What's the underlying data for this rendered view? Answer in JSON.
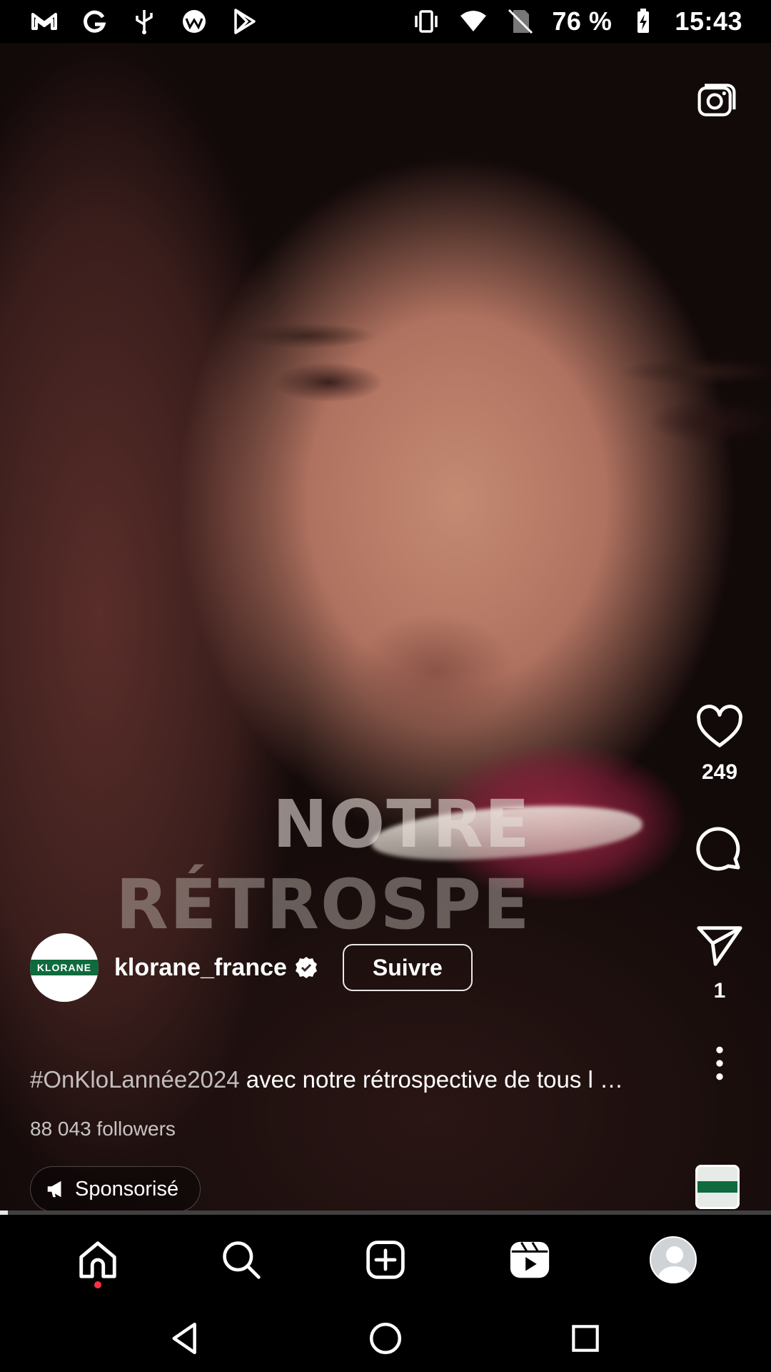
{
  "status_bar": {
    "battery": "76 %",
    "time": "15:43",
    "left_icons": [
      "gmail-icon",
      "google-icon",
      "usb-icon",
      "app-icon",
      "play-store-icon"
    ],
    "right_icons": [
      "vibrate-icon",
      "wifi-icon",
      "no-sim-icon",
      "battery-charging-icon"
    ]
  },
  "reel": {
    "overlay_text": [
      "NOTRE",
      "RÉTROSPE"
    ],
    "author": {
      "username": "klorane_france",
      "avatar_text": "KLORANE",
      "follow_label": "Suivre"
    },
    "caption": {
      "hashtag": "#OnKloLannée2024",
      "text": " avec notre rétrospective de tous l …"
    },
    "followers": "88 043 followers",
    "sponsored_label": "Sponsorisé",
    "likes": "249",
    "shares": "1",
    "progress": 0.01
  },
  "bottom_nav": {
    "items": [
      "home-icon",
      "search-icon",
      "create-icon",
      "reels-icon",
      "profile-avatar"
    ]
  },
  "colors": {
    "brand_green": "#0f6a3e",
    "notification_dot": "#ff3040"
  }
}
